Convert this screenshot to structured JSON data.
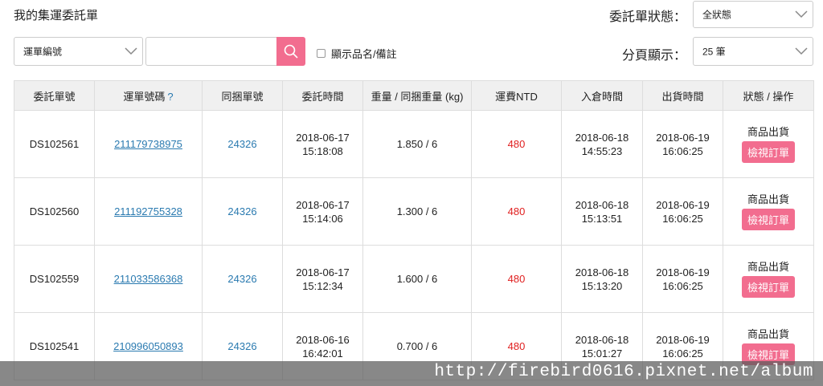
{
  "header": {
    "title": "我的集運委託單"
  },
  "filters": {
    "status_label": "委託單狀態：",
    "status_value": "全狀態",
    "per_page_label": "分頁顯示：",
    "per_page_value": "25 筆",
    "search_type_value": "運單編號",
    "search_placeholder": "",
    "show_note_label": "顯示品名/備註"
  },
  "table": {
    "columns": [
      "委託單號",
      "運單號碼",
      "同捆單號",
      "委託時間",
      "重量 / 同捆重量 (kg)",
      "運費NTD",
      "入倉時間",
      "出貨時間",
      "狀態 / 操作"
    ],
    "help_mark": "?",
    "rows": [
      {
        "order_no": "DS102561",
        "tracking_no": "211179738975",
        "bundle_no": "24326",
        "order_date": "2018-06-17",
        "order_time": "15:18:08",
        "weight": "1.850 / 6",
        "fee": "480",
        "in_date": "2018-06-18",
        "in_time": "14:55:23",
        "ship_date": "2018-06-19",
        "ship_time": "16:06:25",
        "status": "商品出貨",
        "action": "檢視訂單"
      },
      {
        "order_no": "DS102560",
        "tracking_no": "211192755328",
        "bundle_no": "24326",
        "order_date": "2018-06-17",
        "order_time": "15:14:06",
        "weight": "1.300 / 6",
        "fee": "480",
        "in_date": "2018-06-18",
        "in_time": "15:13:51",
        "ship_date": "2018-06-19",
        "ship_time": "16:06:25",
        "status": "商品出貨",
        "action": "檢視訂單"
      },
      {
        "order_no": "DS102559",
        "tracking_no": "211033586368",
        "bundle_no": "24326",
        "order_date": "2018-06-17",
        "order_time": "15:12:34",
        "weight": "1.600 / 6",
        "fee": "480",
        "in_date": "2018-06-18",
        "in_time": "15:13:20",
        "ship_date": "2018-06-19",
        "ship_time": "16:06:25",
        "status": "商品出貨",
        "action": "檢視訂單"
      },
      {
        "order_no": "DS102541",
        "tracking_no": "210996050893",
        "bundle_no": "24326",
        "order_date": "2018-06-16",
        "order_time": "16:42:01",
        "weight": "0.700 / 6",
        "fee": "480",
        "in_date": "2018-06-18",
        "in_time": "15:01:27",
        "ship_date": "2018-06-19",
        "ship_time": "16:06:25",
        "status": "商品出貨",
        "action": "檢視訂單"
      }
    ]
  },
  "watermark": {
    "text": "http://firebird0616.pixnet.net/album"
  },
  "colors": {
    "accent_pink": "#f26d8f",
    "link_blue": "#2a7ab0",
    "fee_red": "#e02020",
    "header_bg": "#f0f0f0"
  },
  "icons": {
    "search": "search-icon",
    "dropdown": "chevron-down-icon"
  }
}
